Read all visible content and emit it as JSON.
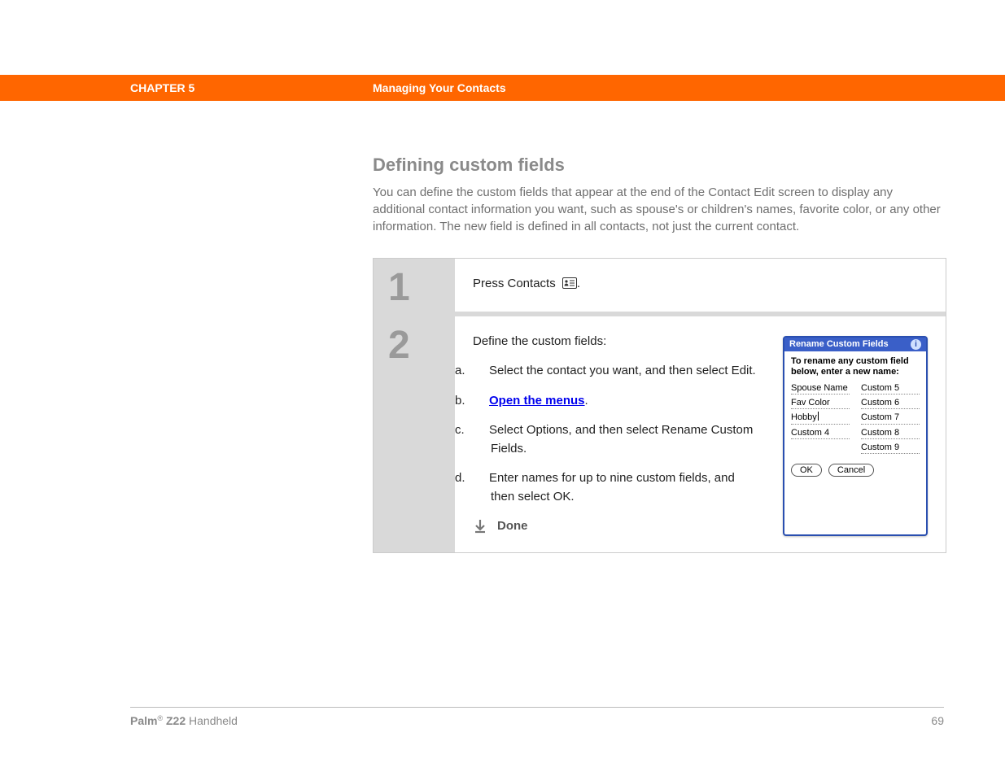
{
  "header": {
    "chapter": "CHAPTER 5",
    "title": "Managing Your Contacts"
  },
  "section": {
    "heading": "Defining custom fields",
    "intro": "You can define the custom fields that appear at the end of the Contact Edit screen to display any additional contact information you want, such as spouse's or children's names, favorite color, or any other information. The new field is defined in all contacts, not just the current contact."
  },
  "steps": [
    {
      "num": "1",
      "text": "Press Contacts ",
      "period": "."
    },
    {
      "num": "2",
      "lead": "Define the custom fields:",
      "items": [
        {
          "lbl": "a.",
          "text": "Select the contact you want, and then select Edit."
        },
        {
          "lbl": "b.",
          "link": "Open the menus",
          "after": "."
        },
        {
          "lbl": "c.",
          "text": "Select Options, and then select Rename Custom Fields."
        },
        {
          "lbl": "d.",
          "text": "Enter names for up to nine custom fields, and then select OK."
        }
      ],
      "done": "Done"
    }
  ],
  "dialog": {
    "title": "Rename Custom Fields",
    "instruction": "To rename any custom field below, enter a new name:",
    "leftFields": [
      "Spouse Name",
      "Fav Color",
      "Hobby",
      "Custom 4"
    ],
    "rightFields": [
      "Custom 5",
      "Custom 6",
      "Custom 7",
      "Custom 8",
      "Custom 9"
    ],
    "ok": "OK",
    "cancel": "Cancel"
  },
  "footer": {
    "brand": "Palm",
    "reg": "®",
    "model": " Z22",
    "suffix": " Handheld",
    "page": "69"
  }
}
